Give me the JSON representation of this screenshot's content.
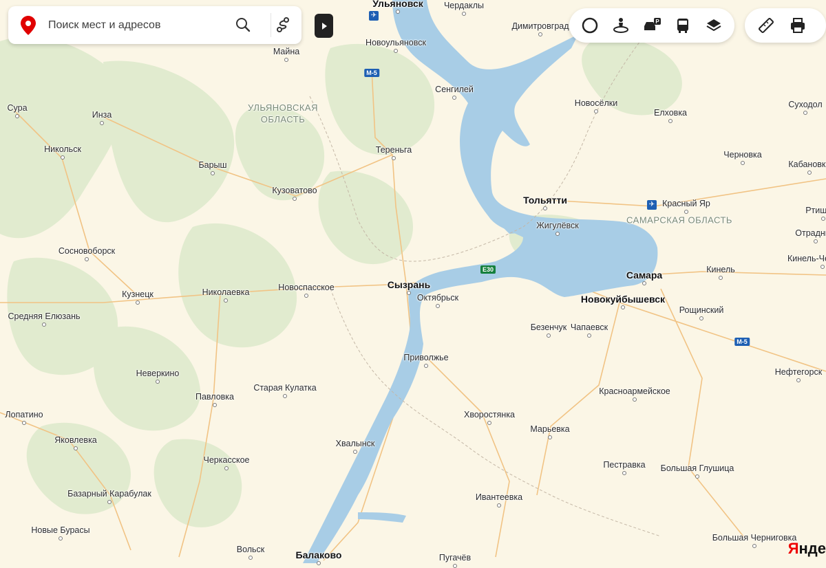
{
  "search": {
    "placeholder": "Поиск мест и адресов"
  },
  "region_labels": [
    {
      "text": "УЛЬЯНОВСКАЯ\nОБЛАСТЬ"
    },
    {
      "text": "САМАРСКАЯ ОБЛАСТЬ"
    }
  ],
  "places": [
    {
      "name": "Ульяновск",
      "type": "big"
    },
    {
      "name": "Чердаклы"
    },
    {
      "name": "Димитровград"
    },
    {
      "name": "Новоульяновск"
    },
    {
      "name": "Майна"
    },
    {
      "name": "Сенгилей"
    },
    {
      "name": "Сура"
    },
    {
      "name": "Инза"
    },
    {
      "name": "Новосёлки"
    },
    {
      "name": "Елховка"
    },
    {
      "name": "Суходол"
    },
    {
      "name": "Никольск"
    },
    {
      "name": "Тереньга"
    },
    {
      "name": "Барыш"
    },
    {
      "name": "Черновка"
    },
    {
      "name": "Кабановка"
    },
    {
      "name": "Кузоватово"
    },
    {
      "name": "Тольятти",
      "type": "big"
    },
    {
      "name": "Красный Яр"
    },
    {
      "name": "Жигулёвск"
    },
    {
      "name": "Отрадный"
    },
    {
      "name": "Сосновоборск"
    },
    {
      "name": "Самара",
      "type": "big"
    },
    {
      "name": "Кинель"
    },
    {
      "name": "Кузнецк"
    },
    {
      "name": "Николаевка"
    },
    {
      "name": "Новоспасское"
    },
    {
      "name": "Сызрань",
      "type": "big"
    },
    {
      "name": "Октябрьск"
    },
    {
      "name": "Новокуйбышевск",
      "type": "big"
    },
    {
      "name": "Средняя Елюзань"
    },
    {
      "name": "Рощинский"
    },
    {
      "name": "Безенчук"
    },
    {
      "name": "Чапаевск"
    },
    {
      "name": "Приволжье"
    },
    {
      "name": "Нефтегорск"
    },
    {
      "name": "Неверкино"
    },
    {
      "name": "Старая Кулатка"
    },
    {
      "name": "Красноармейское"
    },
    {
      "name": "Павловка"
    },
    {
      "name": "Лопатино"
    },
    {
      "name": "Хворостянка"
    },
    {
      "name": "Яковлевка"
    },
    {
      "name": "Марьевка"
    },
    {
      "name": "Хвалынск"
    },
    {
      "name": "Черкасское"
    },
    {
      "name": "Пестравка"
    },
    {
      "name": "Большая Глушица"
    },
    {
      "name": "Базарный Карабулак"
    },
    {
      "name": "Ивантеевка"
    },
    {
      "name": "Новые Бурасы"
    },
    {
      "name": "Большая Черниговка"
    },
    {
      "name": "Вольск"
    },
    {
      "name": "Балаково",
      "type": "big"
    },
    {
      "name": "Пугачёв"
    },
    {
      "name": "Ртищево"
    },
    {
      "name": "Кинель-Черкассы"
    }
  ],
  "highways": [
    {
      "label": "М-5",
      "kind": "m"
    },
    {
      "label": "Е30",
      "kind": "e"
    },
    {
      "label": "М-5",
      "kind": "m"
    }
  ],
  "toolbar": {
    "group1": [
      "traffic-icon",
      "panorama-icon",
      "parking-icon",
      "transit-icon",
      "layers-icon"
    ],
    "group2": [
      "ruler-icon",
      "print-icon"
    ]
  },
  "brand": {
    "part1": "Я",
    "part2": "нде"
  },
  "colors": {
    "land": "#fbf6e6",
    "forest": "#e3ecd2",
    "water": "#a8cde6",
    "road": "#f4c98e",
    "accent": "#e00000"
  }
}
